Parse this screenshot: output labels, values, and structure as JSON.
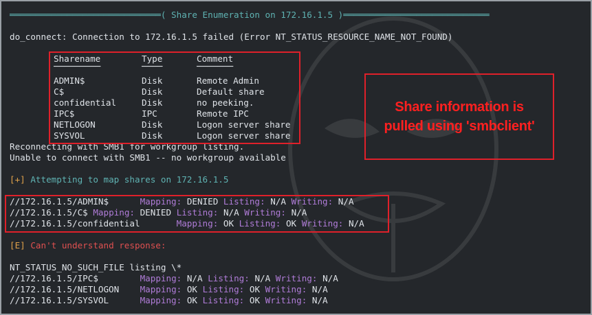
{
  "header": {
    "left_rule": "═════════════════════════════",
    "title": "( Share Enumeration on 172.16.1.5 )",
    "right_rule": "════════════════════════════"
  },
  "connect_error": "do_connect: Connection to 172.16.1.5 failed (Error NT_STATUS_RESOURCE_NAME_NOT_FOUND)",
  "share_table": {
    "headers": [
      "Sharename",
      "Type",
      "Comment"
    ],
    "underlines": [
      "─────────",
      "────",
      "───────"
    ],
    "rows": [
      [
        "ADMIN$",
        "Disk",
        "Remote Admin"
      ],
      [
        "C$",
        "Disk",
        "Default share"
      ],
      [
        "confidential",
        "Disk",
        "no peeking."
      ],
      [
        "IPC$",
        "IPC",
        "Remote IPC"
      ],
      [
        "NETLOGON",
        "Disk",
        "Logon server share"
      ],
      [
        "SYSVOL",
        "Disk",
        "Logon server share"
      ]
    ]
  },
  "smb1_lines": [
    "Reconnecting with SMB1 for workgroup listing.",
    "Unable to connect with SMB1 -- no workgroup available"
  ],
  "attempt": {
    "prefix": "[+]",
    "text": " Attempting to map shares on 172.16.1.5"
  },
  "mapping_labels": {
    "mapping": "Mapping:",
    "listing": "Listing:",
    "writing": "Writing:"
  },
  "mapped_shares": [
    {
      "path": "//172.16.1.5/ADMIN$",
      "pad": "      ",
      "mapping": "DENIED",
      "listing": "N/A",
      "writing": "N/A"
    },
    {
      "path": "//172.16.1.5/C$",
      "pad": " ",
      "mapping": "DENIED",
      "listing": "N/A",
      "writing": "N/A"
    },
    {
      "path": "//172.16.1.5/confidential",
      "pad": "       ",
      "mapping": "OK",
      "listing": "OK",
      "writing": "N/A"
    }
  ],
  "error_line": {
    "prefix": "[E]",
    "text": " Can't understand response:"
  },
  "nt_status_line": "NT_STATUS_NO_SUCH_FILE listing \\*",
  "other_shares": [
    {
      "path": "//172.16.1.5/IPC$",
      "pad": "        ",
      "mapping": "N/A",
      "listing": "N/A",
      "writing": "N/A"
    },
    {
      "path": "//172.16.1.5/NETLOGON",
      "pad": "    ",
      "mapping": "OK",
      "listing": "OK",
      "writing": "N/A"
    },
    {
      "path": "//172.16.1.5/SYSVOL",
      "pad": "      ",
      "mapping": "OK",
      "listing": "OK",
      "writing": "N/A"
    }
  ],
  "annotation": {
    "line1": "Share information is",
    "line2": "pulled using 'smbclient'"
  },
  "colors": {
    "background": "#24272b",
    "header": "#5fb3b3",
    "label": "#b07cd8",
    "info_prefix": "#e0a14a",
    "error": "#e05050",
    "highlight_box": "#e0202a"
  }
}
